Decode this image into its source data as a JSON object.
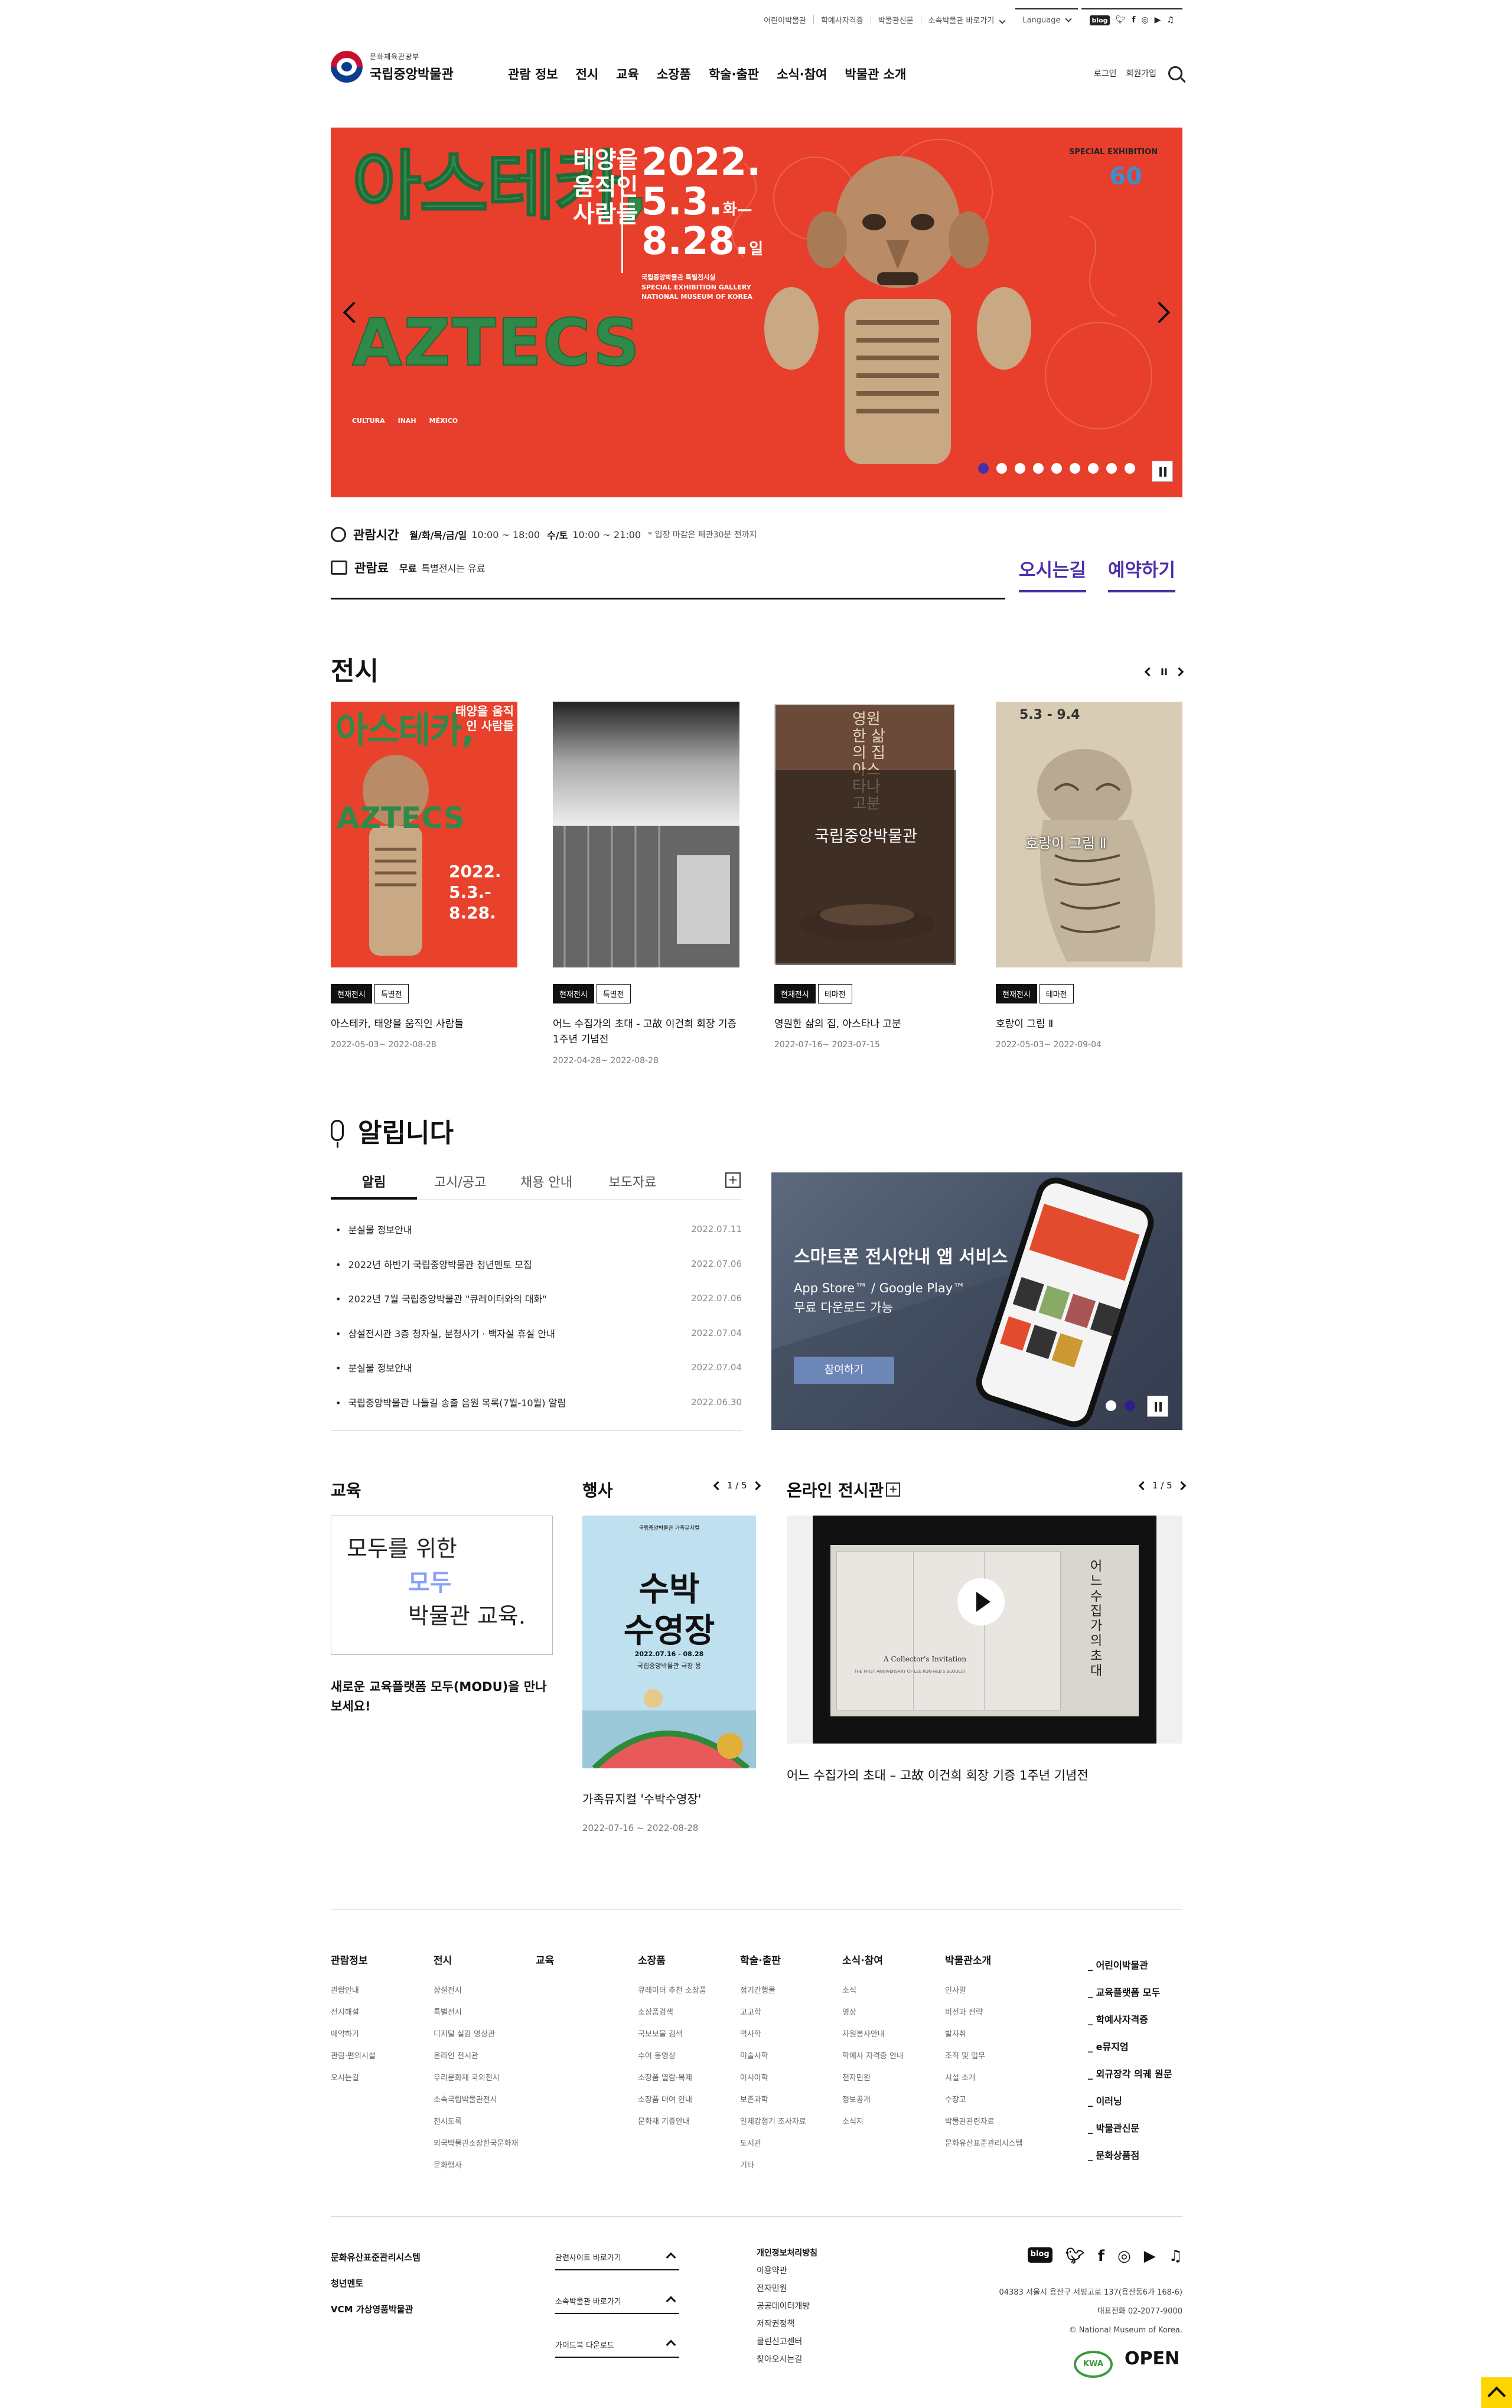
{
  "util": {
    "links": [
      "어린이박물관",
      "학예사자격증",
      "박물관신문",
      "소속박물관 바로가기"
    ],
    "language": "Language",
    "sns": [
      "blog",
      "twitter",
      "facebook",
      "instagram",
      "youtube",
      "podcast"
    ]
  },
  "header": {
    "ministry": "문화체육관광부",
    "museum": "국립중앙박물관",
    "menu": [
      "관람 정보",
      "전시",
      "교육",
      "소장품",
      "학술·출판",
      "소식·참여",
      "박물관 소개"
    ],
    "login": "로그인",
    "join": "회원가입"
  },
  "hero": {
    "title_k": "아스테카,",
    "title_e": "AZTECS",
    "subtitle": "태양을\n움직인\n사람들",
    "year": "2022.",
    "start": "5.3.",
    "start_day": "화",
    "end": "8.28.",
    "end_day": "일",
    "venue": "국립중앙박물관 특별전시실\nSPECIAL EXHIBITION GALLERY\nNATIONAL MUSEUM OF KOREA",
    "special": "SPECIAL EXHIBITION",
    "sponsors": [
      "CULTURA",
      "INAH",
      "MÉXICO"
    ],
    "dots_total": 9,
    "dots_active": 0
  },
  "info": {
    "hours_label": "관람시간",
    "days1": "월/화/목/금/일",
    "time1": "10:00 ~ 18:00",
    "days2": "수/토",
    "time2": "10:00 ~ 21:00",
    "note": "* 입장 마감은 폐관30분 전까지",
    "fee_label": "관람료",
    "fee": "무료",
    "fee_note": "특별전시는 유료",
    "directions": "오시는길",
    "reserve": "예약하기"
  },
  "exhibitions": {
    "title": "전시",
    "pause": "II",
    "items": [
      {
        "tag1": "현재전시",
        "tag2": "특별전",
        "title": "아스테카, 태양을 움직인 사람들",
        "date": "2022-05-03~ 2022-08-28"
      },
      {
        "tag1": "현재전시",
        "tag2": "특별전",
        "title": "어느 수집가의 초대 - 고故 이건희 회장 기증 1주년 기념전",
        "date": "2022-04-28~ 2022-08-28"
      },
      {
        "tag1": "현재전시",
        "tag2": "테마전",
        "title": "영원한 삶의 집, 아스타나 고분",
        "date": "2022-07-16~ 2023-07-15"
      },
      {
        "tag1": "현재전시",
        "tag2": "테마전",
        "title": "호랑이 그림 Ⅱ",
        "date": "2022-05-03~ 2022-09-04"
      }
    ],
    "thumb_text": {
      "aztecs_k": "아스테카,",
      "aztecs_e": "AZTECS",
      "aztecs_sub": "태양을 움직인 사람들",
      "aztecs_date": "2022. 5.3.- 8.28.",
      "astana": "국립중앙박물관",
      "astana_v": "영원한 삶의 집 아스타나 고분",
      "tiger": "호랑이 그림 Ⅱ",
      "tiger_date": "5.3 - 9.4"
    }
  },
  "notice": {
    "title": "알립니다",
    "tabs": [
      "알림",
      "고시/공고",
      "채용 안내",
      "보도자료"
    ],
    "items": [
      {
        "t": "분실물 정보안내",
        "d": "2022.07.11"
      },
      {
        "t": "2022년 하반기 국립중앙박물관 청년멘토 모집",
        "d": "2022.07.06"
      },
      {
        "t": "2022년 7월 국립중앙박물관 \"큐레이터와의 대화\"",
        "d": "2022.07.06"
      },
      {
        "t": "상설전시관 3층 청자실, 분청사기 · 백자실 휴실 안내",
        "d": "2022.07.04"
      },
      {
        "t": "분실물 정보안내",
        "d": "2022.07.04"
      },
      {
        "t": "국립중앙박물관 나들길 송출 음원 목록(7월-10월) 알림",
        "d": "2022.06.30"
      }
    ],
    "app_title": "스마트폰 전시안내 앱 서비스",
    "app_desc": "App Store™ / Google Play™\n무료 다운로드 가능",
    "app_btn": "참여하기"
  },
  "education": {
    "title": "교육",
    "l1": "모두를 위한",
    "l2": "모두",
    "l3": "박물관 교육.",
    "desc": "새로운 교육플랫폼 모두(MODU)을 만나보세요!"
  },
  "events": {
    "title": "행사",
    "page": "1 / 5",
    "poster_top": "국립중앙박물관 가족뮤지컬",
    "poster_big1": "수박",
    "poster_big2": "수영장",
    "poster_date": "2022.07.16 - 08.28",
    "poster_venue": "국립중앙박물관 극장 용",
    "item_title": "가족뮤지컬 '수박수영장'",
    "item_date": "2022-07-16 ~ 2022-08-28"
  },
  "online": {
    "title": "온라인 전시관",
    "page": "1 / 5",
    "video_vertical": "어느 수집가의 초대",
    "video_caption1": "A Collector's Invitation",
    "video_caption2": "THE FIRST ANNIVERSARY OF LEE KUN-HEE'S BEQUEST",
    "item_title": "어느 수집가의 초대 – 고故 이건희 회장 기증 1주년 기념전"
  },
  "footer": {
    "cols": [
      {
        "h": "관람정보",
        "i": [
          "관람안내",
          "전시해설",
          "예약하기",
          "관람·편의시설",
          "오시는길"
        ]
      },
      {
        "h": "전시",
        "i": [
          "상설전시",
          "특별전시",
          "디지털 실감 영상관",
          "온라인 전시관",
          "우리문화재 국외전시",
          "소속국립박물관전시",
          "전시도록",
          "외국박물관소장한국문화재",
          "문화행사"
        ]
      },
      {
        "h": "교육",
        "i": []
      },
      {
        "h": "소장품",
        "i": [
          "큐레이터 추천 소장품",
          "소장품검색",
          "국보보물 검색",
          "수어 동영상",
          "소장품 열람·복제",
          "소장품 대여 안내",
          "문화재 기증안내"
        ]
      },
      {
        "h": "학술·출판",
        "i": [
          "정기간행물",
          "고고학",
          "역사학",
          "미술사학",
          "아시아학",
          "보존과학",
          "일제강점기 조사자료",
          "도서관",
          "기타"
        ]
      },
      {
        "h": "소식·참여",
        "i": [
          "소식",
          "영상",
          "자원봉사안내",
          "학예사 자격증 안내",
          "전자민원",
          "정보공개",
          "소식지"
        ]
      },
      {
        "h": "박물관소개",
        "i": [
          "인사말",
          "비전과 전략",
          "발자취",
          "조직 및 업무",
          "시설 소개",
          "수장고",
          "박물관관련자료",
          "문화유산표준관리시스템"
        ]
      }
    ],
    "quick": [
      "어린이박물관",
      "교육플랫폼 모두",
      "학예사자격증",
      "e뮤지엄",
      "외규장각 의궤 원문",
      "이러닝",
      "박물관신문",
      "문화상품점"
    ],
    "left": [
      "문화유산표준관리시스템",
      "청년멘토",
      "VCM 가상영품박물관"
    ],
    "dropdowns": [
      "관련사이트 바로가기",
      "소속박물관 바로가기",
      "가이드북 다운로드"
    ],
    "mid": [
      "개인정보처리방침",
      "이용약관",
      "전자민원",
      "공공데이터개방",
      "저작권정책",
      "클린신고센터",
      "찾아오시는길"
    ],
    "address": "04383 서울시 용산구 서빙고로 137(용산동6가 168-6)",
    "phone": "대표전화 02-2077-9000",
    "copyright": "© National Museum of Korea.",
    "badge1": "KWA",
    "badge2": "OPEN"
  }
}
